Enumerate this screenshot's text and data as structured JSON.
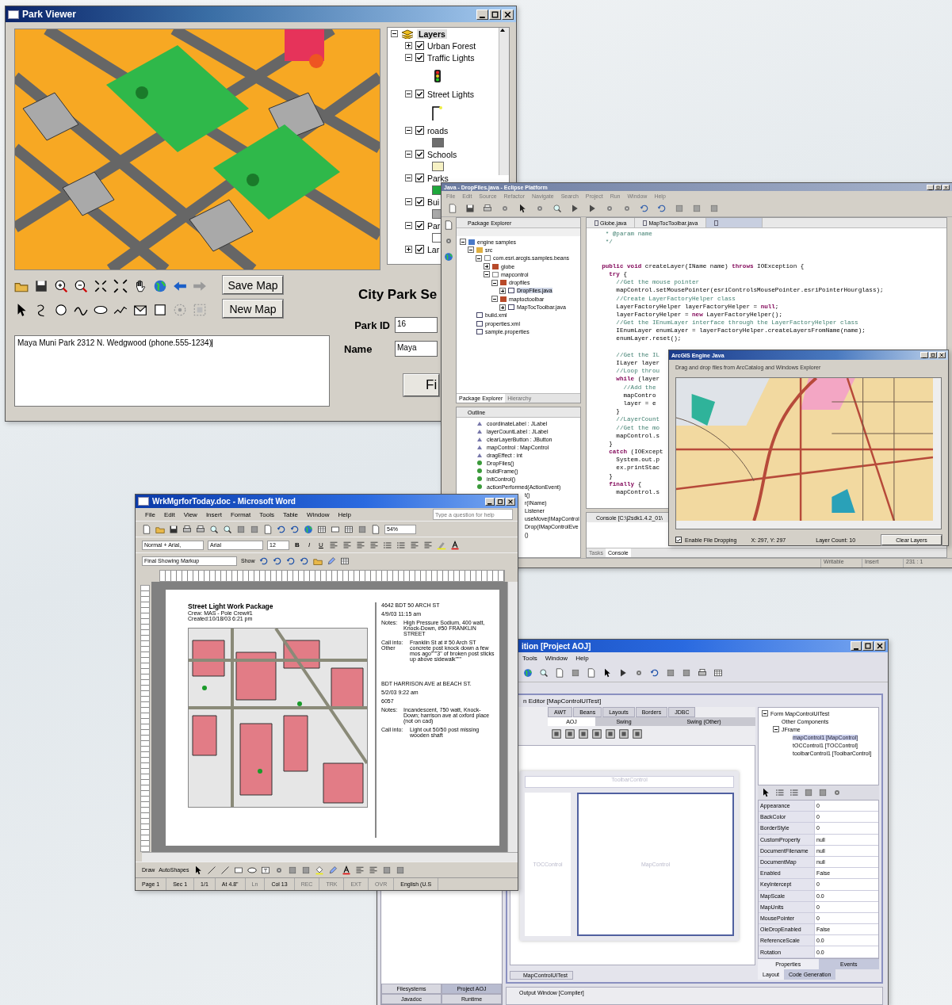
{
  "park_viewer": {
    "title": "Park Viewer",
    "layers": [
      {
        "label": "Layers",
        "expanded": true,
        "kind": "root",
        "children": [
          {
            "label": "Urban Forest",
            "checked": true,
            "expanded": false
          },
          {
            "label": "Traffic Lights",
            "checked": true,
            "expanded": true,
            "children": [
              {
                "kind": "traffic"
              }
            ]
          },
          {
            "label": "Street Lights",
            "checked": true,
            "expanded": true,
            "children": [
              {
                "kind": "lamp"
              }
            ]
          },
          {
            "label": "roads",
            "checked": true,
            "expanded": true,
            "children": [
              {
                "kind": "swatch",
                "color": "#6e6e6e"
              }
            ]
          },
          {
            "label": "Schools",
            "checked": true,
            "expanded": true,
            "children": [
              {
                "kind": "swatch",
                "color": "#f6f1c4"
              }
            ]
          },
          {
            "label": "Parks",
            "checked": true,
            "expanded": true,
            "children": [
              {
                "kind": "swatch",
                "color": "#1fa83c"
              }
            ]
          },
          {
            "label": "Bui",
            "checked": true,
            "expanded": true,
            "children": [
              {
                "kind": "swatch",
                "color": "#a8a8a8"
              }
            ]
          },
          {
            "label": "Par",
            "checked": true,
            "expanded": true,
            "children": [
              {
                "kind": "swatch",
                "color": "#ffffff"
              }
            ]
          },
          {
            "label": "Lar",
            "checked": true,
            "expanded": false
          }
        ]
      }
    ],
    "buttons": [
      "Save Map",
      "New Map"
    ],
    "heading": "City Park Se",
    "fields": [
      {
        "label": "Park ID",
        "value": "16"
      },
      {
        "label": "Name",
        "value": "Maya"
      }
    ],
    "find_button": "Fi",
    "notes": "Maya Muni Park  2312 N. Wedgwood (phone.555-1234)"
  },
  "eclipse": {
    "title": "Java - DropFiles.java - Eclipse Platform",
    "menu": [
      "File",
      "Edit",
      "Source",
      "Refactor",
      "Navigate",
      "Search",
      "Project",
      "Run",
      "Window",
      "Help"
    ],
    "package_explorer": {
      "title": "Package Explorer",
      "tree": [
        {
          "label": "engine samples",
          "kind": "project",
          "expanded": true,
          "selected": false,
          "children": [
            {
              "label": "src",
              "kind": "folder",
              "expanded": true,
              "selected": false,
              "children": [
                {
                  "label": "com.esri.arcgis.samples.beans",
                  "kind": "package",
                  "expanded": true,
                  "selected": false,
                  "children": [
                    {
                      "label": "globe",
                      "kind": "box",
                      "expanded": false,
                      "selected": false
                    },
                    {
                      "label": "mapcontrol",
                      "kind": "package",
                      "expanded": true,
                      "selected": false,
                      "children": [
                        {
                          "label": "dropfiles",
                          "kind": "box",
                          "expanded": true,
                          "selected": false,
                          "children": [
                            {
                              "label": "DropFiles.java",
                              "kind": "java",
                              "expanded": false,
                              "selected": true
                            }
                          ]
                        },
                        {
                          "label": "maptoctoolbar",
                          "kind": "box",
                          "expanded": true,
                          "selected": false,
                          "children": [
                            {
                              "label": "MapTocToolbar.java",
                              "kind": "java",
                              "expanded": false,
                              "selected": false
                            }
                          ]
                        }
                      ]
                    }
                  ]
                }
              ]
            },
            {
              "label": "build.xml",
              "kind": "xml",
              "selected": false
            },
            {
              "label": "properties.xml",
              "kind": "xml",
              "selected": false
            },
            {
              "label": "sample.properties",
              "kind": "file",
              "selected": false
            }
          ]
        }
      ],
      "tabs": [
        {
          "label": "Package Explorer",
          "selected": true
        },
        {
          "label": "Hierarchy",
          "selected": false
        }
      ]
    },
    "outline": {
      "title": "Outline",
      "items": [
        {
          "label": "coordinateLabel : JLabel",
          "kind": "field"
        },
        {
          "label": "layerCountLabel : JLabel",
          "kind": "field"
        },
        {
          "label": "clearLayerButton : JButton",
          "kind": "field"
        },
        {
          "label": "mapControl : MapControl",
          "kind": "field"
        },
        {
          "label": "dragEffect : int",
          "kind": "field"
        },
        {
          "label": "DropFiles()",
          "kind": "method"
        },
        {
          "label": "buildFrame()",
          "kind": "method"
        },
        {
          "label": "initControl()",
          "kind": "method"
        },
        {
          "label": "actionPerformed(ActionEvent)",
          "kind": "method"
        },
        {
          "label": "t()",
          "kind": "partial"
        },
        {
          "label": "r(IName)",
          "kind": "partial"
        },
        {
          "label": "Listener",
          "kind": "partial"
        },
        {
          "label": "useMove(IMapControl",
          "kind": "partial"
        },
        {
          "label": "Drop(IMapControlEve",
          "kind": "partial"
        },
        {
          "label": "()",
          "kind": "partial"
        }
      ]
    },
    "editor_tabs": [
      {
        "label": "Globe.java",
        "selected": false
      },
      {
        "label": "MapTocToolbar.java",
        "selected": false
      },
      {
        "selected": true
      }
    ],
    "code": [
      {
        "kind": "comment",
        "text": "   * @param name"
      },
      {
        "kind": "comment",
        "text": "   */"
      },
      {
        "kind": "blank"
      },
      {
        "kind": "blank"
      },
      {
        "kind": "code",
        "text": "  **public void** createLayer(IName name) **throws** IOException {"
      },
      {
        "kind": "code",
        "text": "    **try** {"
      },
      {
        "kind": "comment",
        "text": "      //Get the mouse pointer"
      },
      {
        "kind": "code",
        "text": "      mapControl.setMousePointer(esriControlsMousePointer.esriPointerHourglass);"
      },
      {
        "kind": "comment",
        "text": "      //Create LayerFactoryHelper class"
      },
      {
        "kind": "code",
        "text": "      LayerFactoryHelper layerFactoryHelper = **null**;"
      },
      {
        "kind": "code",
        "text": "      layerFactoryHelper = **new** LayerFactoryHelper();"
      },
      {
        "kind": "comment",
        "text": "      //Get the IEnumLayer interface through the LayerFactoryHelper class"
      },
      {
        "kind": "code",
        "text": "      IEnumLayer enumLayer = layerFactoryHelper.createLayersFromName(name);"
      },
      {
        "kind": "code",
        "text": "      enumLayer.reset();"
      },
      {
        "kind": "blank"
      },
      {
        "kind": "comment",
        "text": "      //Get the IL"
      },
      {
        "kind": "code",
        "text": "      ILayer layer"
      },
      {
        "kind": "comment",
        "text": "      //Loop throu"
      },
      {
        "kind": "code",
        "text": "      **while** (layer"
      },
      {
        "kind": "comment",
        "text": "        //Add the"
      },
      {
        "kind": "code",
        "text": "        mapContro"
      },
      {
        "kind": "code",
        "text": "        layer = e"
      },
      {
        "kind": "code",
        "text": "      }"
      },
      {
        "kind": "comment",
        "text": "      //LayerCount"
      },
      {
        "kind": "comment",
        "text": "      //Get the mo"
      },
      {
        "kind": "code",
        "text": "      mapControl.s"
      },
      {
        "kind": "code",
        "text": "    }"
      },
      {
        "kind": "code",
        "text": "    **catch** (IOExcept"
      },
      {
        "kind": "code",
        "text": "      System.out.p"
      },
      {
        "kind": "code",
        "text": "      ex.printStac"
      },
      {
        "kind": "code",
        "text": "    }"
      },
      {
        "kind": "code",
        "text": "    **finally** {"
      },
      {
        "kind": "code",
        "text": "      mapControl.s"
      }
    ],
    "console": "Console [C:\\j2sdk1.4.2_01\\",
    "bottom_tabs": [
      {
        "label": "Tasks",
        "selected": false
      },
      {
        "label": "Console",
        "selected": true
      }
    ],
    "status_bar": [
      "Writable",
      "Insert",
      "231 : 1"
    ],
    "arcgis_dialog": {
      "title": "ArcGIS Engine Java",
      "instructions": "Drag and drop files from ArcCatalog and Windows Explorer",
      "enable_dropping": {
        "label": "Enable File Dropping",
        "checked": true
      },
      "coordinates": "X: 297, Y: 297",
      "layer_count": "Layer Count: 10",
      "button": "Clear Layers"
    }
  },
  "word": {
    "title": "WrkMgrforToday.doc - Microsoft Word",
    "menu": [
      "File",
      "Edit",
      "View",
      "Insert",
      "Format",
      "Tools",
      "Table",
      "Window",
      "Help"
    ],
    "help_box": {
      "placeholder": "Type a question for help"
    },
    "zoom": "54%",
    "style": "Normal + Arial,",
    "font": "Arial",
    "font_size": "12",
    "format_buttons": [
      "B",
      "I",
      "U"
    ],
    "markup_view": "Final Showing Markup",
    "show_menu": "Show",
    "document": {
      "title": "Street Light Work Package",
      "crew": "Crew:     MAS - Pole Crew#1",
      "created": "Created:10/18/03 6:21 pm",
      "work_items": [
        {
          "header": "4642    BDT  50 ARCH ST",
          "time": "4/9/03  11:15 am",
          "notes_label": "Notes:",
          "notes": "High Pressure Sodium, 400 watt, Knock-Down, #50 FRANKLIN STREET",
          "call_label": "Call into: Other",
          "call": "Franklin St at # 50 Arch ST concrete post knock down a few mos ago\"\"\"3\" of broken post sticks up above sidewalk\"\"\""
        },
        {
          "header": "BDT HARRISON AVE at BEACH ST.",
          "time": "5/2/03  9:22 am",
          "id": "6057",
          "notes_label": "Notes:",
          "notes": "Incandescent, 750 watt, Knock-Down; harrison ave at oxford place (not on cad)",
          "call_label": "Call into:",
          "call": "Light out    50/50 post missing wooden shaft"
        }
      ]
    },
    "draw_menu": "Draw",
    "autoshapes_menu": "AutoShapes",
    "status_bar": [
      {
        "label": "Page 1",
        "disabled": false
      },
      {
        "label": "Sec 1",
        "disabled": false
      },
      {
        "label": "1/1",
        "disabled": false
      },
      {
        "label": "At 4.8\"",
        "disabled": false
      },
      {
        "label": "Ln",
        "disabled": true
      },
      {
        "label": "Col 13",
        "disabled": false
      },
      {
        "label": "REC",
        "disabled": true
      },
      {
        "label": "TRK",
        "disabled": true
      },
      {
        "label": "EXT",
        "disabled": true
      },
      {
        "label": "OVR",
        "disabled": true
      },
      {
        "label": "English (U.S",
        "disabled": false
      }
    ]
  },
  "aoj": {
    "title": "ition [Project AOJ]",
    "menu": [
      "Tools",
      "Window",
      "Help"
    ],
    "editor_title": "n Editor [MapControlUITest]",
    "palette_tabs": [
      {
        "label": "AWT",
        "selected": false
      },
      {
        "label": "Beans",
        "selected": false
      },
      {
        "label": "Layouts",
        "selected": false
      },
      {
        "label": "Borders",
        "selected": false
      },
      {
        "label": "JDBC",
        "selected": false
      }
    ],
    "palette_subtabs": [
      {
        "label": "AOJ",
        "selected": true
      },
      {
        "label": "Swing",
        "selected": false
      },
      {
        "label": "Swing (Other)",
        "selected": false
      }
    ],
    "design": {
      "toolbar": "ToolbarControl",
      "toc": "TOCControl",
      "map": "MapControl"
    },
    "components": [
      {
        "label": "Form MapControlUITest",
        "expanded": true,
        "selected": false,
        "children": [
          {
            "label": "Other Components",
            "selected": false
          },
          {
            "label": "JFrame",
            "expanded": true,
            "selected": false,
            "children": [
              {
                "label": "mapControl1 [MapControl]",
                "selected": true
              },
              {
                "label": "tOCControl1 [TOCControl]",
                "selected": false
              },
              {
                "label": "toolbarControl1 [ToolbarControl]",
                "selected": false
              }
            ]
          }
        ]
      }
    ],
    "properties": [
      {
        "name": "Appearance",
        "value": "0"
      },
      {
        "name": "BackColor",
        "value": "0"
      },
      {
        "name": "BorderStyle",
        "value": "0"
      },
      {
        "name": "CustomProperty",
        "value": "null"
      },
      {
        "name": "DocumentFilename",
        "value": "null"
      },
      {
        "name": "DocumentMap",
        "value": "null"
      },
      {
        "name": "Enabled",
        "value": "False"
      },
      {
        "name": "KeyIntercept",
        "value": "0"
      },
      {
        "name": "MapScale",
        "value": "0.0"
      },
      {
        "name": "MapUnits",
        "value": "0"
      },
      {
        "name": "MousePointer",
        "value": "0"
      },
      {
        "name": "OleDropEnabled",
        "value": "False"
      },
      {
        "name": "ReferenceScale",
        "value": "0.0"
      },
      {
        "name": "Rotation",
        "value": "0.0"
      }
    ],
    "property_tabs": [
      {
        "label": "Properties",
        "selected": true
      },
      {
        "label": "Events",
        "selected": false
      }
    ],
    "code_tabs": [
      {
        "label": "Layout",
        "selected": true
      },
      {
        "label": "Code Generation",
        "selected": false
      }
    ],
    "form_tab": "MapControlUITest",
    "output": "Output Window [Compiler]",
    "explorer_tabs": [
      {
        "label": "Filesystems",
        "selected": false
      },
      {
        "label": "Project AOJ",
        "selected": true
      }
    ],
    "explorer_tabs_2": [
      {
        "label": "Javadoc",
        "selected": false
      },
      {
        "label": "Runtime",
        "selected": false
      }
    ]
  }
}
